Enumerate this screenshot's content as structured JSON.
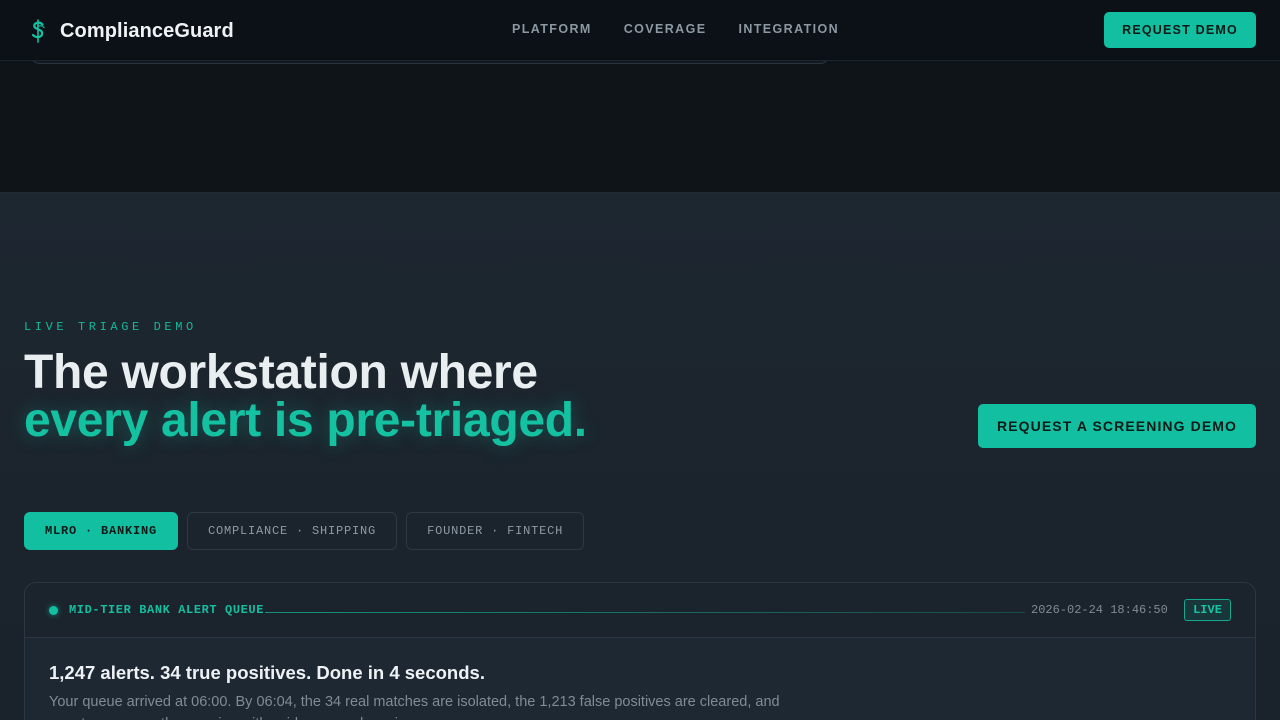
{
  "nav": {
    "brand": "ComplianceGuard",
    "links": [
      "PLATFORM",
      "COVERAGE",
      "INTEGRATION"
    ],
    "cta": "REQUEST DEMO"
  },
  "hero": {
    "eyebrow": "LIVE TRIAGE DEMO",
    "headline_line1": "The workstation where",
    "headline_line2": "every alert is pre-triaged.",
    "cta": "REQUEST A SCREENING DEMO"
  },
  "tabs": [
    {
      "label": "MLRO · BANKING",
      "active": true
    },
    {
      "label": "COMPLIANCE · SHIPPING",
      "active": false
    },
    {
      "label": "FOUNDER · FINTECH",
      "active": false
    }
  ],
  "panel": {
    "queue_label": "MID-TIER BANK ALERT QUEUE",
    "timestamp": "2026-02-24 18:46:50",
    "status": "LIVE",
    "title": "1,247 alerts. 34 true positives. Done in 4 seconds.",
    "body": "Your queue arrived at 06:00. By 06:04, the 34 real matches are isolated, the 1,213 false positives are cleared, and your team opens the morning with evidence-ready reviews."
  },
  "colors": {
    "accent": "#12bfa0",
    "background": "#1a222b",
    "nav_background": "#0b1116"
  }
}
